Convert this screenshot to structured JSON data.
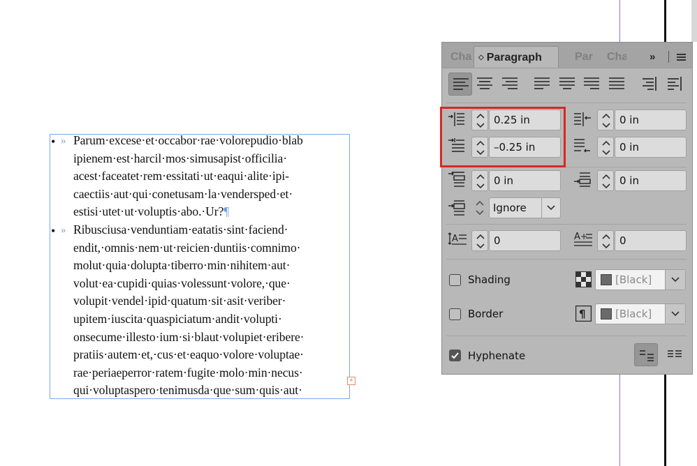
{
  "document": {
    "paragraphs": [
      {
        "bullet": "•",
        "tab_marker": "»",
        "lines": [
          "Parum·excese·et·occabor·rae·volorepudio·blab",
          "ipienem·est·harcil·mos·simusapist·officilia·",
          "acest·faceatet·rem·essitati·ut·eaqui·alite·ipi-",
          "caectiis·aut·qui·conetusam·la·vendersped·et·",
          "estisi·utet·ut·voluptis·abo.·Ur?"
        ],
        "end_mark": "¶"
      },
      {
        "bullet": "•",
        "tab_marker": "»",
        "lines": [
          "Ribusciusa·venduntiam·eatatis·sint·faciend·",
          "endit,·omnis·nem·ut·reicien·duntiis·comnimo·",
          "molut·quia·dolupta·tiberro·min·nihitem·aut·",
          "volut·ea·cupidi·quias·volessunt·volore,·que·",
          "volupit·vendel·ipid·quatum·sit·asit·veriber·",
          "upitem·iuscita·quaspiciatum·andit·volupti·",
          "onsecume·illesto·ium·si·blaut·volupiet·eribere·",
          "pratiis·autem·et,·cus·et·eaquo·volore·voluptae·",
          "rae·periaeperror·ratem·fugite·molo·min·necus·",
          "qui·voluptaspero·tenimusda·que·sum·quis·aut·"
        ]
      }
    ],
    "overset_marker": "+"
  },
  "panel": {
    "tabs": [
      {
        "label": "Cha",
        "active": false
      },
      {
        "label": "Paragraph",
        "active": true
      },
      {
        "label": "Par",
        "active": false
      },
      {
        "label": "Cha",
        "active": false
      }
    ],
    "overflow_label": "»",
    "indents": {
      "left_indent": "0.25 in",
      "right_indent": "0 in",
      "first_line_indent": "–0.25 in",
      "last_line_right_indent": "0 in"
    },
    "spacing": {
      "space_before": "0 in",
      "space_after": "0 in",
      "align_to_grid": "Ignore"
    },
    "drop_cap": {
      "lines": "0",
      "characters": "0"
    },
    "shading": {
      "label": "Shading",
      "checked": false,
      "color": "[Black]"
    },
    "border": {
      "label": "Border",
      "checked": false,
      "color": "[Black]"
    },
    "hyphenate": {
      "label": "Hyphenate",
      "checked": true
    }
  }
}
